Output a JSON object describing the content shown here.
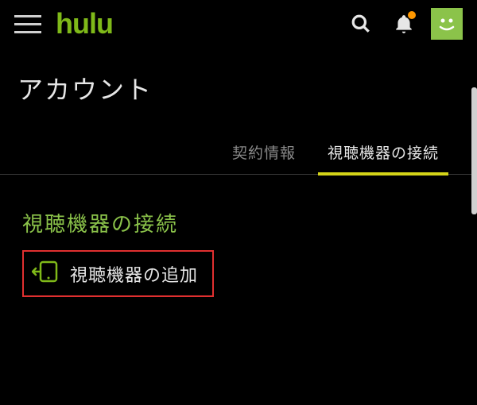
{
  "header": {
    "logo": "hulu"
  },
  "page": {
    "title": "アカウント"
  },
  "tabs": [
    {
      "label": "契約情報",
      "active": false
    },
    {
      "label": "視聴機器の接続",
      "active": true
    }
  ],
  "section": {
    "title": "視聴機器の接続",
    "add_device_label": "視聴機器の追加"
  },
  "colors": {
    "brand_green": "#7fb919",
    "accent_green": "#8bc34a",
    "tab_underline": "#d4d419",
    "highlight_border": "#e03030",
    "notification_dot": "#ff9800"
  }
}
